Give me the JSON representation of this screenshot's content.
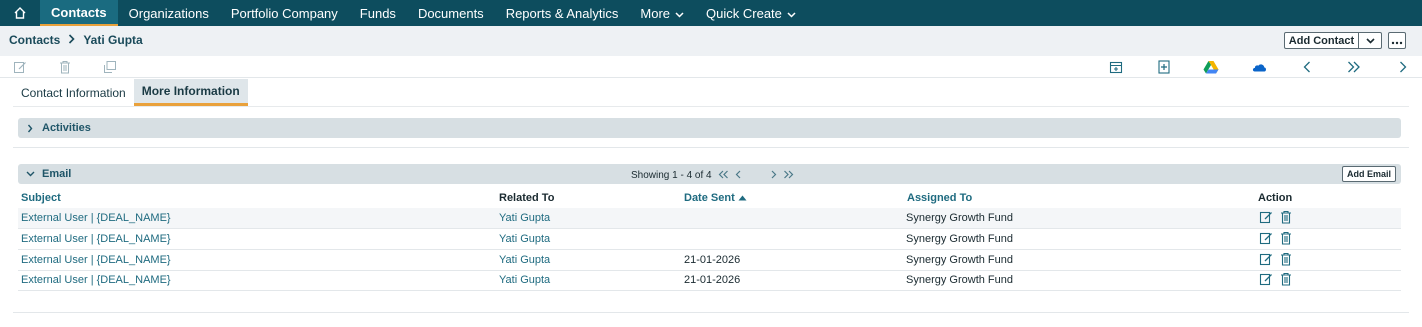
{
  "nav": {
    "items": [
      {
        "label": "Contacts",
        "active": true
      },
      {
        "label": "Organizations"
      },
      {
        "label": "Portfolio Company"
      },
      {
        "label": "Funds"
      },
      {
        "label": "Documents"
      },
      {
        "label": "Reports & Analytics"
      },
      {
        "label": "More"
      },
      {
        "label": "Quick Create"
      }
    ]
  },
  "breadcrumb": {
    "parent": "Contacts",
    "current": "Yati Gupta"
  },
  "header": {
    "add_contact_label": "Add Contact"
  },
  "tabs": [
    {
      "label": "Contact Information"
    },
    {
      "label": "More Information",
      "active": true
    }
  ],
  "activities": {
    "title": "Activities"
  },
  "email": {
    "title": "Email",
    "pager": "Showing 1 - 4 of 4",
    "add_label": "Add Email",
    "columns": {
      "subject": "Subject",
      "related_to": "Related To",
      "date_sent": "Date Sent",
      "assigned_to": "Assigned To",
      "action": "Action"
    },
    "rows": [
      {
        "subject": "External User | {DEAL_NAME}",
        "related_to": "Yati Gupta",
        "date_sent": "",
        "assigned_to": "Synergy Growth Fund"
      },
      {
        "subject": "External User | {DEAL_NAME}",
        "related_to": "Yati Gupta",
        "date_sent": "",
        "assigned_to": "Synergy Growth Fund"
      },
      {
        "subject": "External User | {DEAL_NAME}",
        "related_to": "Yati Gupta",
        "date_sent": "21-01-2026",
        "assigned_to": "Synergy Growth Fund"
      },
      {
        "subject": "External User | {DEAL_NAME}",
        "related_to": "Yati Gupta",
        "date_sent": "21-01-2026",
        "assigned_to": "Synergy Growth Fund"
      }
    ]
  },
  "colors": {
    "nav_bg": "#0d4d5e",
    "accent": "#e9a13b",
    "link": "#1f6b80"
  }
}
